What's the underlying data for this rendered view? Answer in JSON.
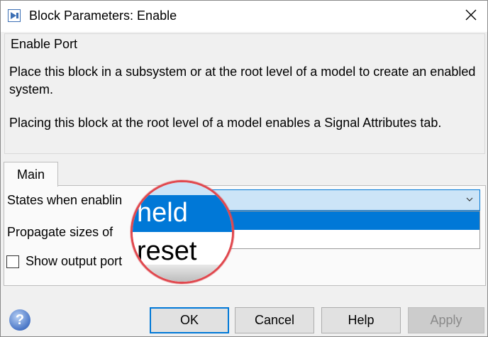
{
  "window": {
    "title": "Block Parameters: Enable",
    "close_glyph": "✕",
    "app_icon": "simulink-block-icon"
  },
  "description": {
    "group_title": "Enable Port",
    "paragraph1": "Place this block in a subsystem or at the root level of a model to create an enabled system.",
    "paragraph2": "Placing this block at the root level of a model enables a Signal Attributes tab."
  },
  "tabs": [
    {
      "label": "Main",
      "selected": true
    }
  ],
  "parameters": {
    "states_label": "States when enablin",
    "states_value": "held",
    "states_options": [
      "held",
      "reset"
    ],
    "propagate_label": "Propagate sizes of",
    "show_output_port_label": "Show output port",
    "show_output_port_checked": false
  },
  "magnifier": {
    "highlighted_option": "held",
    "other_option": "reset"
  },
  "buttons": {
    "help_icon_glyph": "?",
    "ok": "OK",
    "cancel": "Cancel",
    "help": "Help",
    "apply": "Apply"
  },
  "colors": {
    "accent": "#0078d7",
    "magnifier_ring": "#e0484e",
    "combo_bg": "#cce4f7"
  }
}
